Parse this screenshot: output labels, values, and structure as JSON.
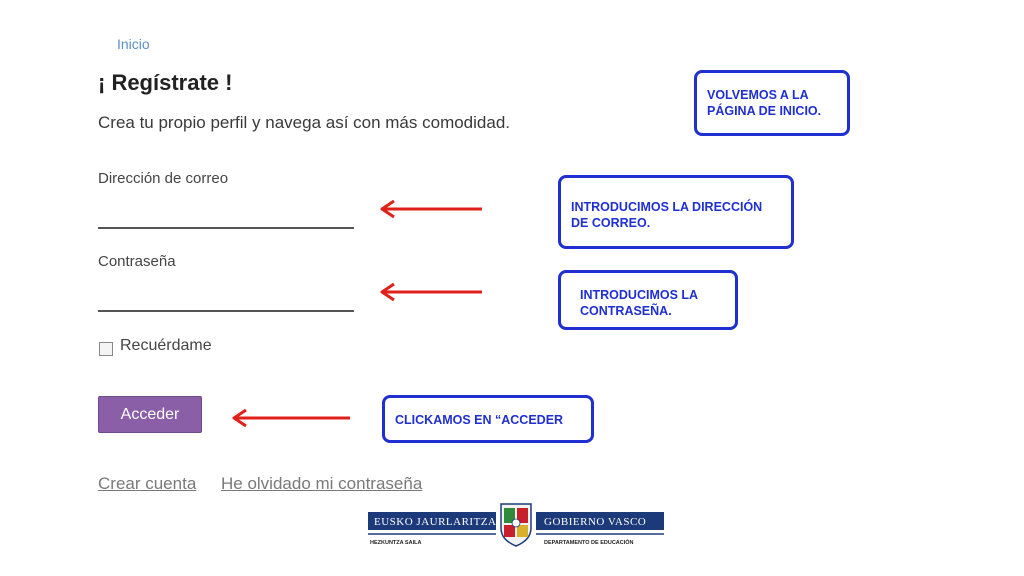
{
  "header": {
    "inicio_link": "Inicio",
    "title": "¡ Regístrate !",
    "subtitle": "Crea tu propio perfil y navega así con más comodidad."
  },
  "form": {
    "email_label": "Dirección de correo",
    "email_value": "",
    "password_label": "Contraseña",
    "password_value": "",
    "remember_label": "Recuérdame",
    "remember_checked": false,
    "submit_label": "Acceder"
  },
  "links": {
    "create_account": "Crear cuenta",
    "forgot_password": "He olvidado mi contraseña"
  },
  "callouts": {
    "inicio": "VOLVEMOS A LA PÁGINA DE INICIO.",
    "correo": "INTRODUCIMOS LA DIRECCIÓN DE CORREO.",
    "contrasena": "INTRODUCIMOS LA CONTRASEÑA.",
    "acceder": "CLICKAMOS EN “ACCEDER"
  },
  "footer": {
    "logo_left_title": "EUSKO JAURLARITZA",
    "logo_right_title": "GOBIERNO VASCO",
    "logo_left_sub": "HEZKUNTZA SAILA",
    "logo_right_sub": "DEPARTAMENTO DE EDUCACIÓN"
  },
  "colors": {
    "callout_blue": "#1f2fd0",
    "arrow_red": "#e0201a",
    "button_purple": "#8a5fa8",
    "link_blue": "#5b8fc9",
    "logo_navy": "#1c3a7a"
  },
  "icons": [
    "left-arrow-icon",
    "checkbox-icon",
    "coat-of-arms-icon"
  ]
}
